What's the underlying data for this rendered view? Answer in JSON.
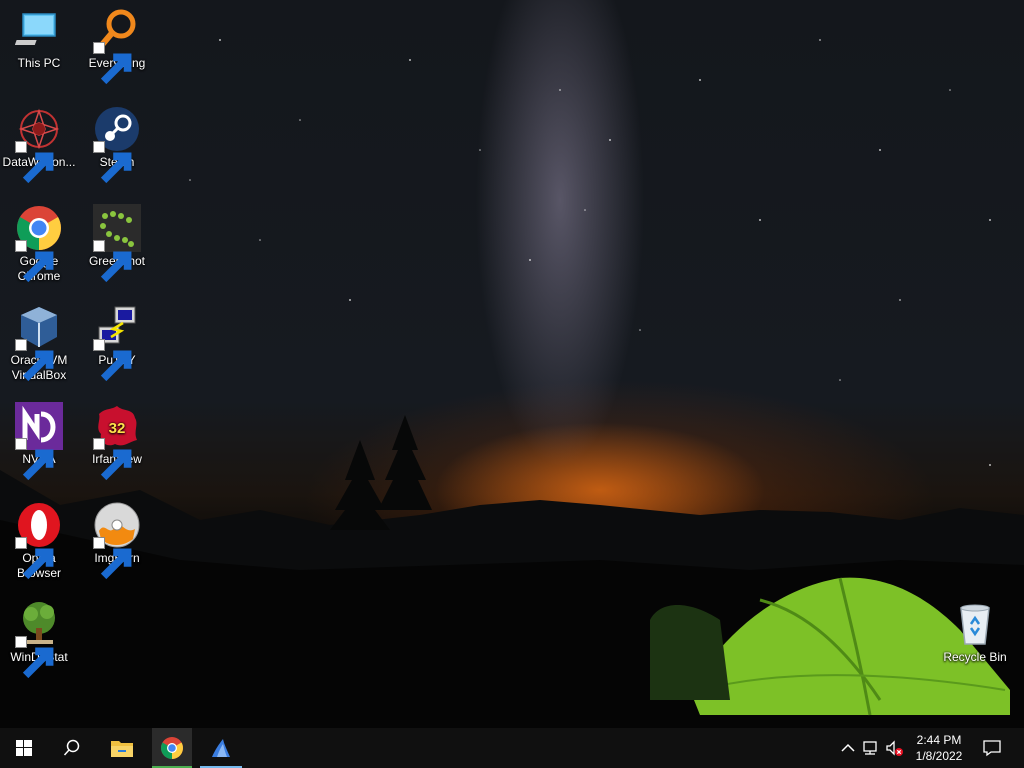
{
  "desktop": {
    "icons": [
      {
        "label": "This PC",
        "icon": "this-pc-icon"
      },
      {
        "label": "Everything",
        "icon": "everything-icon"
      },
      {
        "label": "DataWagon...",
        "icon": "datawagon-icon"
      },
      {
        "label": "Steam",
        "icon": "steam-icon"
      },
      {
        "label": "Google Chrome",
        "icon": "chrome-icon"
      },
      {
        "label": "Greenshot",
        "icon": "greenshot-icon"
      },
      {
        "label": "Oracle VM VirtualBox",
        "icon": "virtualbox-icon"
      },
      {
        "label": "PuTTY",
        "icon": "putty-icon"
      },
      {
        "label": "NVDA",
        "icon": "nvda-icon"
      },
      {
        "label": "IrfanView",
        "icon": "irfanview-icon"
      },
      {
        "label": "Opera Browser",
        "icon": "opera-icon"
      },
      {
        "label": "ImgBurn",
        "icon": "imgburn-icon"
      },
      {
        "label": "WinDirStat",
        "icon": "windirstat-icon"
      },
      {
        "label": "Recycle Bin",
        "icon": "recycle-bin-icon"
      }
    ],
    "irfanview_badge": "32"
  },
  "taskbar": {
    "start": "windows-logo-icon",
    "search": "search-icon",
    "pinned": [
      "file-explorer-icon",
      "chrome-icon",
      "app-icon"
    ],
    "tray": [
      "chevron-up-icon",
      "network-icon",
      "volume-muted-icon"
    ],
    "clock": {
      "time": "2:44 PM",
      "date": "1/8/2022"
    },
    "notifications": "action-center-icon"
  }
}
